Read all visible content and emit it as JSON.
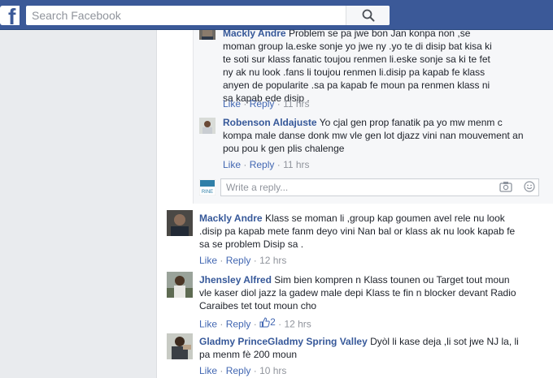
{
  "topbar": {
    "logo": "f",
    "search_placeholder": "Search Facebook"
  },
  "comments": [
    {
      "author": "Mackly Andre",
      "text": "Problem se pa jwe bon Jan konpa non ,se moman group la.eske sonje yo jwe ny .yo te di disip bat kisa ki te soti sur klass fanatic toujou renmen li.eske sonje sa ki te fet ny ak nu look .fans li toujou renmen li.disip pa kapab fe klass anyen de popularite .sa pa kapab fe moun pa renmen klass ni sa kapab ede disip .",
      "like": "Like",
      "reply": "Reply",
      "time": "11 hrs"
    },
    {
      "author": "Robenson Aldajuste",
      "text": "Yo cjal gen prop fanatik pa yo mw menm c kompa male danse donk mw vle gen lot djazz vini nan mouvement an pou pou k gen plis chalenge",
      "like": "Like",
      "reply": "Reply",
      "time": "11 hrs"
    },
    {
      "author": "Mackly Andre",
      "text": "Klass se moman li ,group kap goumen avel rele nu look .disip pa kapab mete fanm deyo vini Nan bal or klass ak nu look kapab fe sa se problem Disip sa .",
      "like": "Like",
      "reply": "Reply",
      "time": "12 hrs"
    },
    {
      "author": "Jhensley Alfred",
      "text": "Sim bien kompren n Klass tounen ou Target tout moun vle kaser diol jazz la gadew male depi Klass te fin n blocker devant Radio Caraibes tet tout moun cho",
      "like": "Like",
      "reply": "Reply",
      "likes": "2",
      "time": "12 hrs"
    },
    {
      "author": "Gladmy PrinceGladmy Spring Valley",
      "text": "Dyòl li kase deja ,li sot jwe NJ la, li pa menm fè 200 moun",
      "like": "Like",
      "reply": "Reply",
      "time": "10 hrs"
    }
  ],
  "write_reply": {
    "placeholder": "Write a reply...",
    "avatar_text": "RINE"
  },
  "colors": {
    "topbar": "#3b5998",
    "link": "#365899",
    "action_link": "#4267b2",
    "muted": "#90949c"
  }
}
